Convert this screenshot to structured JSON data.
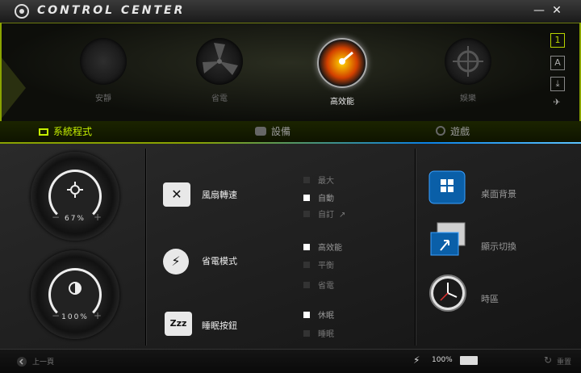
{
  "app": {
    "title": "CONTROL CENTER"
  },
  "window": {
    "minimize_label": "—",
    "close_label": "✕"
  },
  "modes": [
    {
      "label": "安靜",
      "icon": "speaker-icon",
      "active": false
    },
    {
      "label": "省電",
      "icon": "fan-icon",
      "active": false
    },
    {
      "label": "高效能",
      "icon": "speedometer-icon",
      "active": true
    },
    {
      "label": "娛樂",
      "icon": "crosshair-icon",
      "active": false
    }
  ],
  "side_icons": [
    "1",
    "A",
    "⤓",
    "✈"
  ],
  "tabs": [
    {
      "label": "系統程式",
      "icon": "monitor-icon",
      "active": true
    },
    {
      "label": "設備",
      "icon": "devices-icon",
      "active": false
    },
    {
      "label": "遊戲",
      "icon": "gamepad-icon",
      "active": false
    }
  ],
  "dials": [
    {
      "name": "volume",
      "icon": "speaker-dial-icon",
      "value": "67%"
    },
    {
      "name": "brightness",
      "icon": "brightness-icon",
      "value": "100%"
    }
  ],
  "features": [
    {
      "label": "風扇轉速",
      "icon": "fan-box-icon",
      "options": [
        {
          "label": "最大",
          "checked": false
        },
        {
          "label": "自動",
          "checked": true
        },
        {
          "label": "自訂",
          "checked": false
        }
      ]
    },
    {
      "label": "省電模式",
      "icon": "power-plug-icon",
      "options": [
        {
          "label": "高效能",
          "checked": true
        },
        {
          "label": "平衡",
          "checked": false
        },
        {
          "label": "省電",
          "checked": false
        }
      ]
    },
    {
      "label": "睡眠按鈕",
      "icon": "zzz-icon",
      "options": [
        {
          "label": "休眠",
          "checked": true
        },
        {
          "label": "睡眠",
          "checked": false
        }
      ]
    }
  ],
  "right_features": [
    {
      "label": "桌面背景",
      "icon": "windows-desktop-icon"
    },
    {
      "label": "顯示切換",
      "icon": "display-switch-icon"
    },
    {
      "label": "時區",
      "icon": "clock-icon"
    }
  ],
  "status": {
    "back_label": "上一頁",
    "battery": "100%",
    "reset_label": "重置"
  },
  "colors": {
    "accent": "#9fc800",
    "tab_active": "#c6f000",
    "blue": "#0b82e6"
  }
}
